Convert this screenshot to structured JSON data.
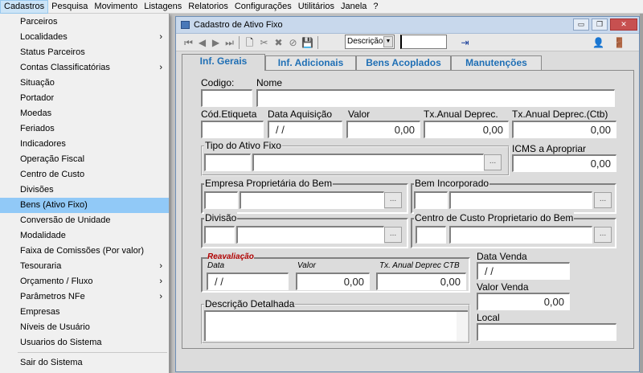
{
  "menubar": {
    "items": [
      "Cadastros",
      "Pesquisa",
      "Movimento",
      "Listagens",
      "Relatorios",
      "Configurações",
      "Utilitários",
      "Janela",
      "?"
    ]
  },
  "menu": {
    "items": [
      {
        "label": "Parceiros",
        "sub": false
      },
      {
        "label": "Localidades",
        "sub": true
      },
      {
        "label": "Status Parceiros",
        "sub": false
      },
      {
        "label": "Contas Classificatórias",
        "sub": true
      },
      {
        "label": "Situação",
        "sub": false
      },
      {
        "label": "Portador",
        "sub": false
      },
      {
        "label": "Moedas",
        "sub": false
      },
      {
        "label": "Feriados",
        "sub": false
      },
      {
        "label": "Indicadores",
        "sub": false
      },
      {
        "label": "Operação Fiscal",
        "sub": false
      },
      {
        "label": "Centro de Custo",
        "sub": false
      },
      {
        "label": "Divisões",
        "sub": false
      },
      {
        "label": "Bens (Ativo Fixo)",
        "sub": false,
        "selected": true
      },
      {
        "label": "Conversão de Unidade",
        "sub": false
      },
      {
        "label": "Modalidade",
        "sub": false
      },
      {
        "label": "Faixa de Comissões (Por valor)",
        "sub": false
      },
      {
        "label": "Tesouraria",
        "sub": true
      },
      {
        "label": "Orçamento / Fluxo",
        "sub": true
      },
      {
        "label": "Parâmetros NFe",
        "sub": true
      },
      {
        "label": "Empresas",
        "sub": false
      },
      {
        "label": "Níveis de Usuário",
        "sub": false
      },
      {
        "label": "Usuarios do Sistema",
        "sub": false
      }
    ],
    "exit": "Sair do Sistema",
    "arrow": "›"
  },
  "window": {
    "title": "Cadastro de Ativo Fixo",
    "controls": {
      "minimize": "▭",
      "restore": "❐",
      "close": "✕"
    },
    "toolbar": {
      "icons": [
        "⏮",
        "◀",
        "▶",
        "⏭",
        "🗋",
        "✂",
        "✖",
        "⊘",
        "💾"
      ],
      "sort_value": "Descrição",
      "sort_arrow": "▼",
      "search_value": "",
      "export_icon": "⇥",
      "user_icon": "👤",
      "exit_icon": "🚪"
    },
    "tabs": [
      "Inf. Gerais",
      "Inf. Adicionais",
      "Bens Acoplados",
      "Manutenções"
    ],
    "form": {
      "codigo_label": "Codigo:",
      "nome_label": "Nome",
      "cod_etiqueta_label": "Cód.Etiqueta",
      "data_aquisicao_label": "Data Aquisição",
      "data_aquisicao_value": "/ /",
      "valor_label": "Valor",
      "valor_value": "0,00",
      "tx_anual_label": "Tx.Anual Deprec.",
      "tx_anual_value": "0,00",
      "tx_anual_ctb_label": "Tx.Anual Deprec.(Ctb)",
      "tx_anual_ctb_value": "0,00",
      "tipo_ativo_label": "Tipo do Ativo Fixo",
      "icms_label": "ICMS a Apropriar",
      "icms_value": "0,00",
      "empresa_label": "Empresa Proprietária do Bem",
      "bem_incorporado_label": "Bem Incorporado",
      "divisao_label": "Divisão",
      "centro_custo_label": "Centro de Custo Proprietario do Bem",
      "reavaliacao_label": "Reavaliação",
      "reav_data_label": "Data",
      "reav_data_value": "/ /",
      "reav_valor_label": "Valor",
      "reav_valor_value": "0,00",
      "reav_tx_label": "Tx. Anual Deprec CTB",
      "reav_tx_value": "0,00",
      "data_venda_label": "Data Venda",
      "data_venda_value": "/ /",
      "valor_venda_label": "Valor Venda",
      "valor_venda_value": "0,00",
      "descricao_label": "Descrição Detalhada",
      "local_label": "Local",
      "lookup_dots": "..."
    }
  }
}
